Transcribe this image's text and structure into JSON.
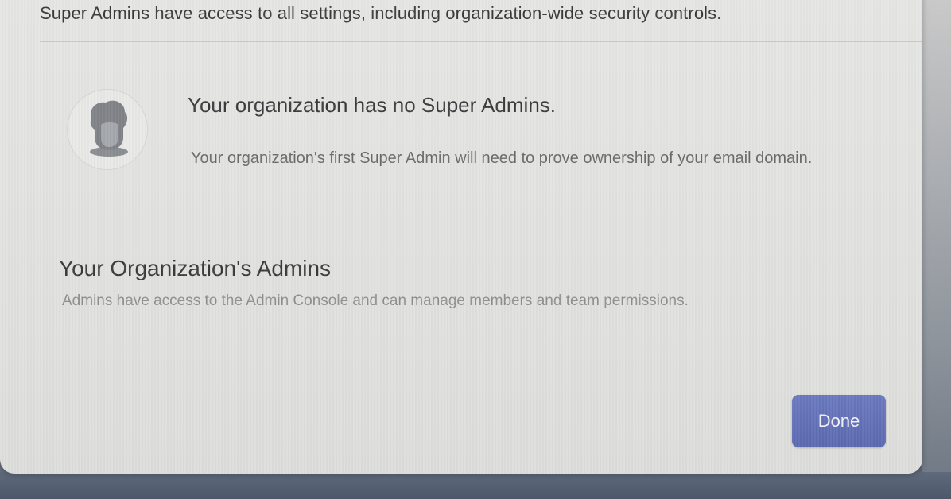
{
  "super_admins": {
    "description": "Super Admins have access to all settings, including organization-wide security controls.",
    "empty_state": {
      "avatar_icon": "person-avatar-icon",
      "title": "Your organization has no Super Admins.",
      "description": "Your organization's first Super Admin will need to prove ownership of your email domain."
    }
  },
  "admins": {
    "title": "Your Organization's Admins",
    "description": "Admins have access to the Admin Console and can manage members and team permissions."
  },
  "footer": {
    "done_label": "Done"
  },
  "colors": {
    "primary_button": "#5f6db4",
    "modal_background": "#e3e3e1"
  }
}
